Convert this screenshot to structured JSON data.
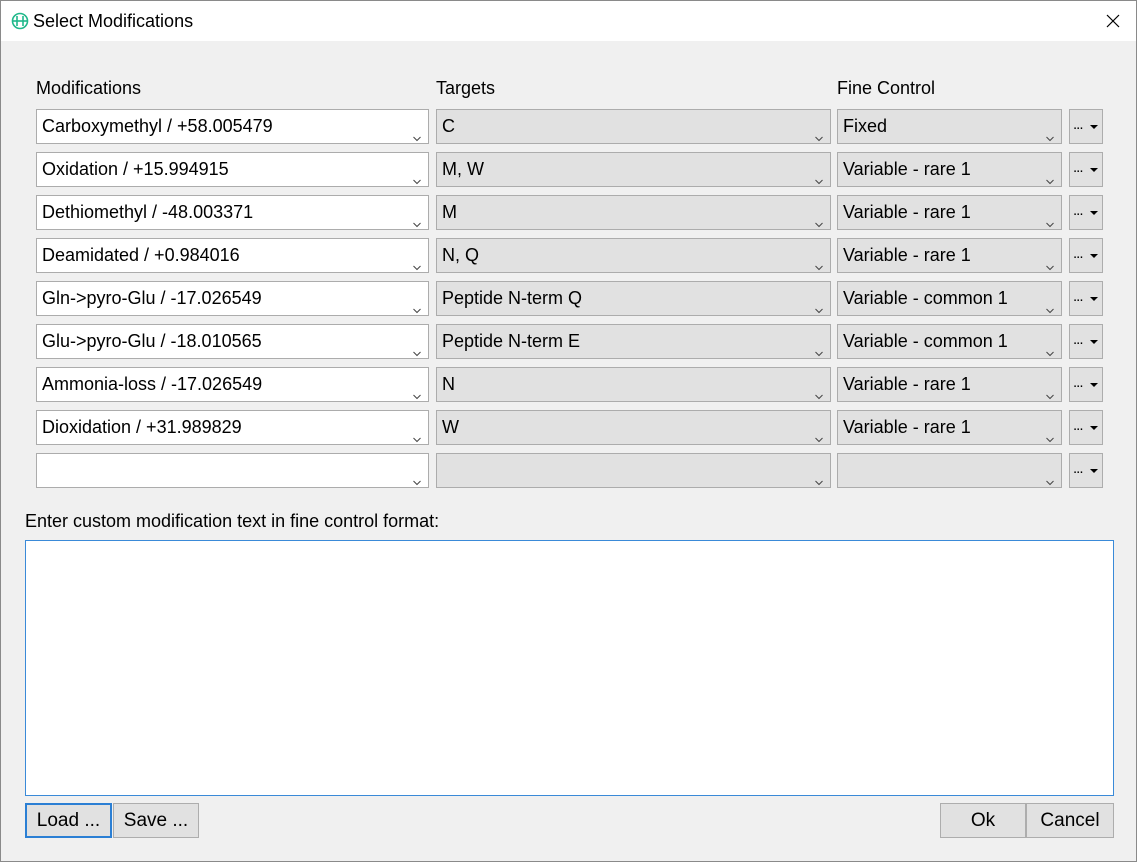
{
  "window": {
    "title": "Select Modifications",
    "icon": "app-logo-icon",
    "close_icon": "close-icon"
  },
  "headers": {
    "modifications": "Modifications",
    "targets": "Targets",
    "fine_control": "Fine Control"
  },
  "rows": [
    {
      "modification": "Carboxymethyl / +58.005479",
      "targets": "C",
      "fine_control": "Fixed",
      "more": "..."
    },
    {
      "modification": "Oxidation / +15.994915",
      "targets": "M, W",
      "fine_control": "Variable - rare 1",
      "more": "..."
    },
    {
      "modification": "Dethiomethyl / -48.003371",
      "targets": "M",
      "fine_control": "Variable - rare 1",
      "more": "..."
    },
    {
      "modification": "Deamidated / +0.984016",
      "targets": "N, Q",
      "fine_control": "Variable - rare 1",
      "more": "..."
    },
    {
      "modification": "Gln->pyro-Glu / -17.026549",
      "targets": "Peptide N-term Q",
      "fine_control": "Variable - common 1",
      "more": "..."
    },
    {
      "modification": "Glu->pyro-Glu / -18.010565",
      "targets": "Peptide N-term E",
      "fine_control": "Variable - common 1",
      "more": "..."
    },
    {
      "modification": "Ammonia-loss / -17.026549",
      "targets": "N",
      "fine_control": "Variable - rare 1",
      "more": "..."
    },
    {
      "modification": "Dioxidation / +31.989829",
      "targets": "W",
      "fine_control": "Variable - rare 1",
      "more": "..."
    },
    {
      "modification": "",
      "targets": "",
      "fine_control": "",
      "more": "..."
    }
  ],
  "custom": {
    "label": "Enter custom modification text in fine control format:",
    "value": ""
  },
  "buttons": {
    "load": "Load ...",
    "save": "Save ...",
    "ok": "Ok",
    "cancel": "Cancel"
  },
  "colors": {
    "accent": "#2b7fd4",
    "logo": "#1fb88a"
  }
}
